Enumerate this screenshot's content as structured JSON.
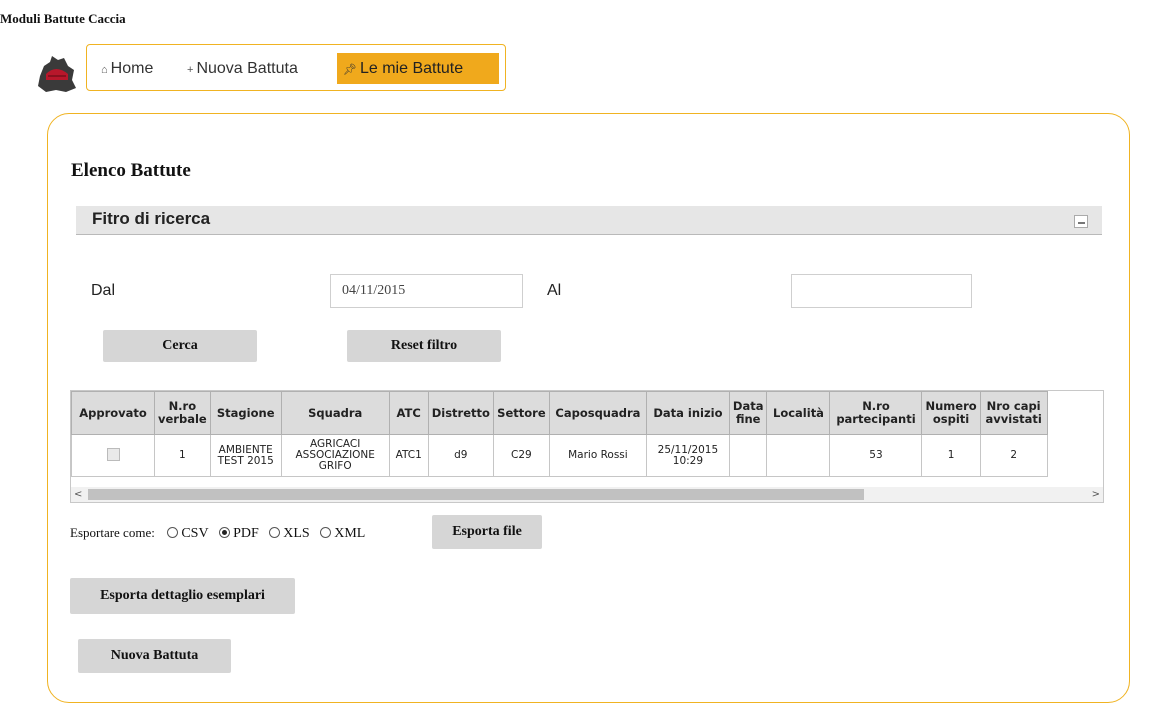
{
  "app": {
    "title": "Moduli Battute Caccia"
  },
  "nav": {
    "items": [
      {
        "label": "Home",
        "icon": "home-icon",
        "active": false
      },
      {
        "label": "Nuova Battuta",
        "icon": "plus-icon",
        "active": false
      },
      {
        "label": "Le mie Battute",
        "icon": "pin-icon",
        "active": true
      }
    ]
  },
  "page": {
    "title": "Elenco Battute"
  },
  "filter": {
    "title": "Fitro di ricerca",
    "dal_label": "Dal",
    "dal_value": "04/11/2015",
    "al_label": "Al",
    "al_value": "",
    "search_button": "Cerca",
    "reset_button": "Reset filtro"
  },
  "table": {
    "columns": [
      "Approvato",
      "N.ro verbale",
      "Stagione",
      "Squadra",
      "ATC",
      "Distretto",
      "Settore",
      "Caposquadra",
      "Data inizio",
      "Data fine",
      "Località",
      "N.ro partecipanti",
      "Numero ospiti",
      "Nro capi avvistati"
    ],
    "rows": [
      {
        "approvato": false,
        "verbale": "1",
        "stagione": "AMBIENTE TEST 2015",
        "squadra": "AGRICACI ASSOCIAZIONE GRIFO",
        "atc": "ATC1",
        "distretto": "d9",
        "settore": "C29",
        "caposquadra": "Mario Rossi",
        "data_inizio": "25/11/2015 10:29",
        "data_fine": "",
        "localita": "",
        "partecipanti": "53",
        "ospiti": "1",
        "capi_avvistati": "2"
      }
    ]
  },
  "export": {
    "label": "Esportare come:",
    "options": [
      "CSV",
      "PDF",
      "XLS",
      "XML"
    ],
    "selected": "PDF",
    "button": "Esporta file"
  },
  "actions": {
    "detail_button": "Esporta dettaglio esemplari",
    "new_button": "Nuova Battuta"
  },
  "colors": {
    "accent": "#f0a91c",
    "border": "#f0b322"
  }
}
